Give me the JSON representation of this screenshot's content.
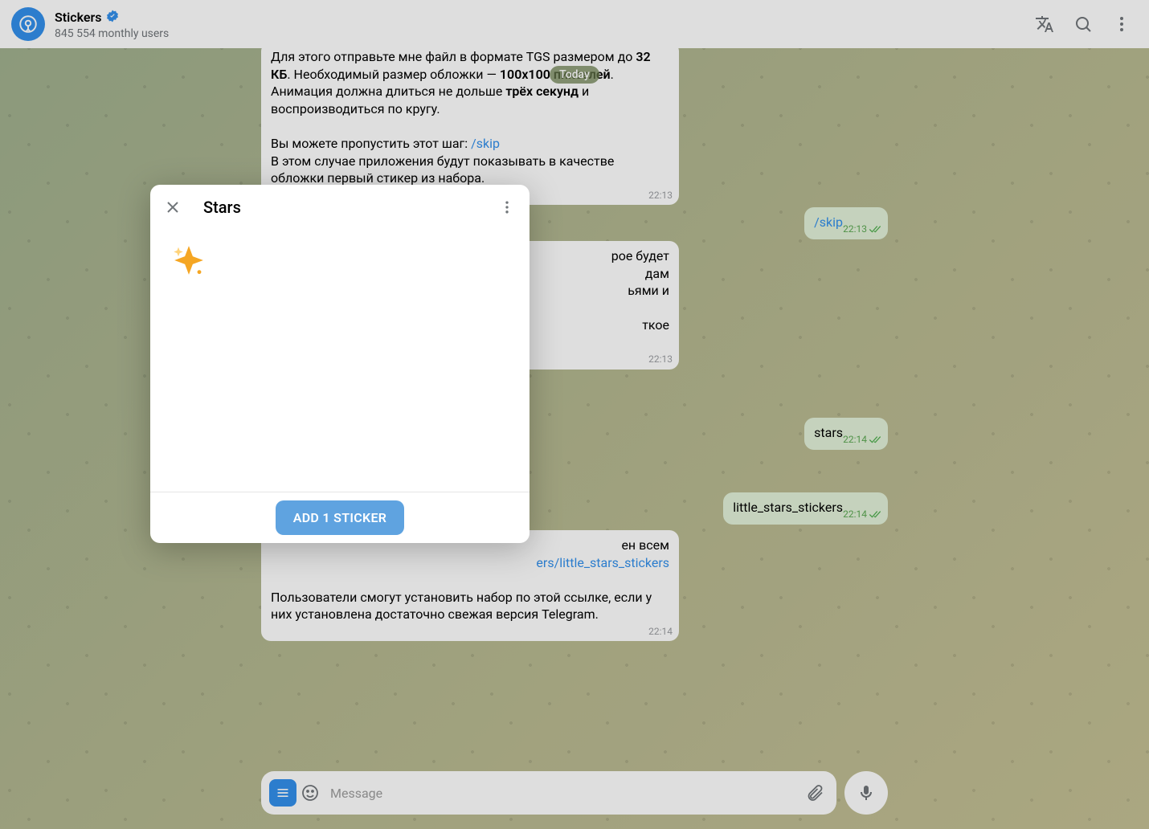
{
  "header": {
    "title": "Stickers",
    "subtitle": "845 554 monthly users",
    "verified": true
  },
  "date_chip": "Today",
  "messages": {
    "m1": {
      "prefix": "Для этого отправьте мне файл в формате TGS размером до ",
      "b1": "32 КБ",
      "mid1": ". Необходимый размер обложки — ",
      "b2": "100x100 пикселей",
      "mid2": ". Анимация должна длиться не дольше ",
      "b3": "трёх секунд",
      "suffix1": " и воспроизводиться по кругу.",
      "skip_intro": "Вы можете пропустить этот шаг: ",
      "skip_cmd": "/skip",
      "skip_after": "В этом случае приложения будут показывать в качестве обложки первый стикер из набора.",
      "time": "22:13"
    },
    "m2": {
      "text": "/skip",
      "time": "22:13"
    },
    "m3": {
      "frag1": "рое будет",
      "frag2": "дам",
      "frag3": "ьями и",
      "frag4": "ткое",
      "time": "22:13"
    },
    "m4": {
      "text": "stars",
      "time": "22:14"
    },
    "m5": {
      "text": "little_stars_stickers",
      "time": "22:14"
    },
    "m6": {
      "frag_top": "ен всем",
      "link_frag": "ers/little_stars_stickers",
      "body": "Пользователи смогут установить набор по этой ссылке, если у них установлена достаточно свежая версия Telegram.",
      "time": "22:14"
    }
  },
  "composer": {
    "placeholder": "Message"
  },
  "modal": {
    "title": "Stars",
    "button": "ADD 1 STICKER"
  }
}
